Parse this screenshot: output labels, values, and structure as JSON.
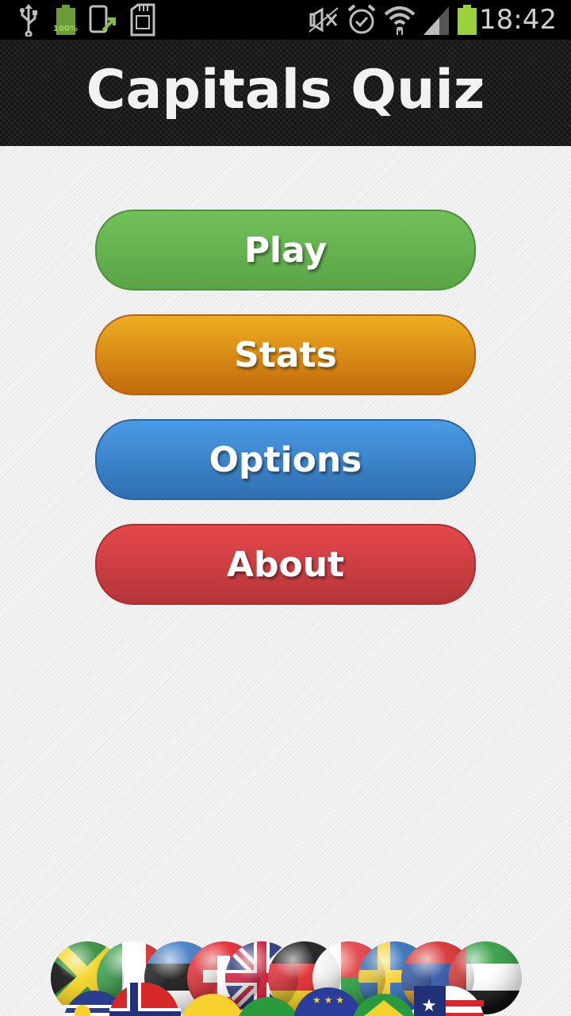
{
  "status_bar": {
    "time": "18:42",
    "battery_percent_label": "100%",
    "icons": [
      "usb-icon",
      "battery-full-small-icon",
      "screenshot-share-icon",
      "sd-card-icon",
      "mute-icon",
      "alarm-icon",
      "wifi-icon",
      "signal-icon",
      "battery-icon"
    ]
  },
  "header": {
    "title": "Capitals Quiz"
  },
  "menu": {
    "items": [
      {
        "label": "Play",
        "color": "#5fab4b"
      },
      {
        "label": "Stats",
        "color": "#e08c17"
      },
      {
        "label": "Options",
        "color": "#3b83cd"
      },
      {
        "label": "About",
        "color": "#cf3e41"
      }
    ]
  },
  "decoration": {
    "flags": [
      "jamaica",
      "italy",
      "estonia",
      "switzerland",
      "united-kingdom",
      "germany",
      "madagascar",
      "sweden",
      "armenia",
      "uae",
      "malaysia",
      "norway",
      "lithuania",
      "nigeria",
      "european-union",
      "brazil",
      "liberia"
    ]
  }
}
